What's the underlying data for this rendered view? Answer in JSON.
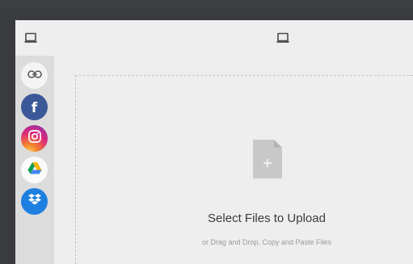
{
  "icons": {
    "header_left": "laptop-icon",
    "header_center": "laptop-icon",
    "file": "file-plus-icon"
  },
  "sidebar": {
    "sources": [
      {
        "name": "link",
        "icon": "link-icon",
        "color": "#f4f4f4"
      },
      {
        "name": "facebook",
        "icon": "facebook-icon",
        "color": "#3b5998",
        "glyph": "f"
      },
      {
        "name": "instagram",
        "icon": "instagram-icon",
        "color": "#dd2a7b"
      },
      {
        "name": "google-drive",
        "icon": "google-drive-icon",
        "color": "#fafafa"
      },
      {
        "name": "dropbox",
        "icon": "dropbox-icon",
        "color": "#1d7fe0"
      }
    ]
  },
  "dropzone": {
    "title": "Select Files to Upload",
    "subtitle": "or Drag and Drop, Copy and Paste Files"
  }
}
